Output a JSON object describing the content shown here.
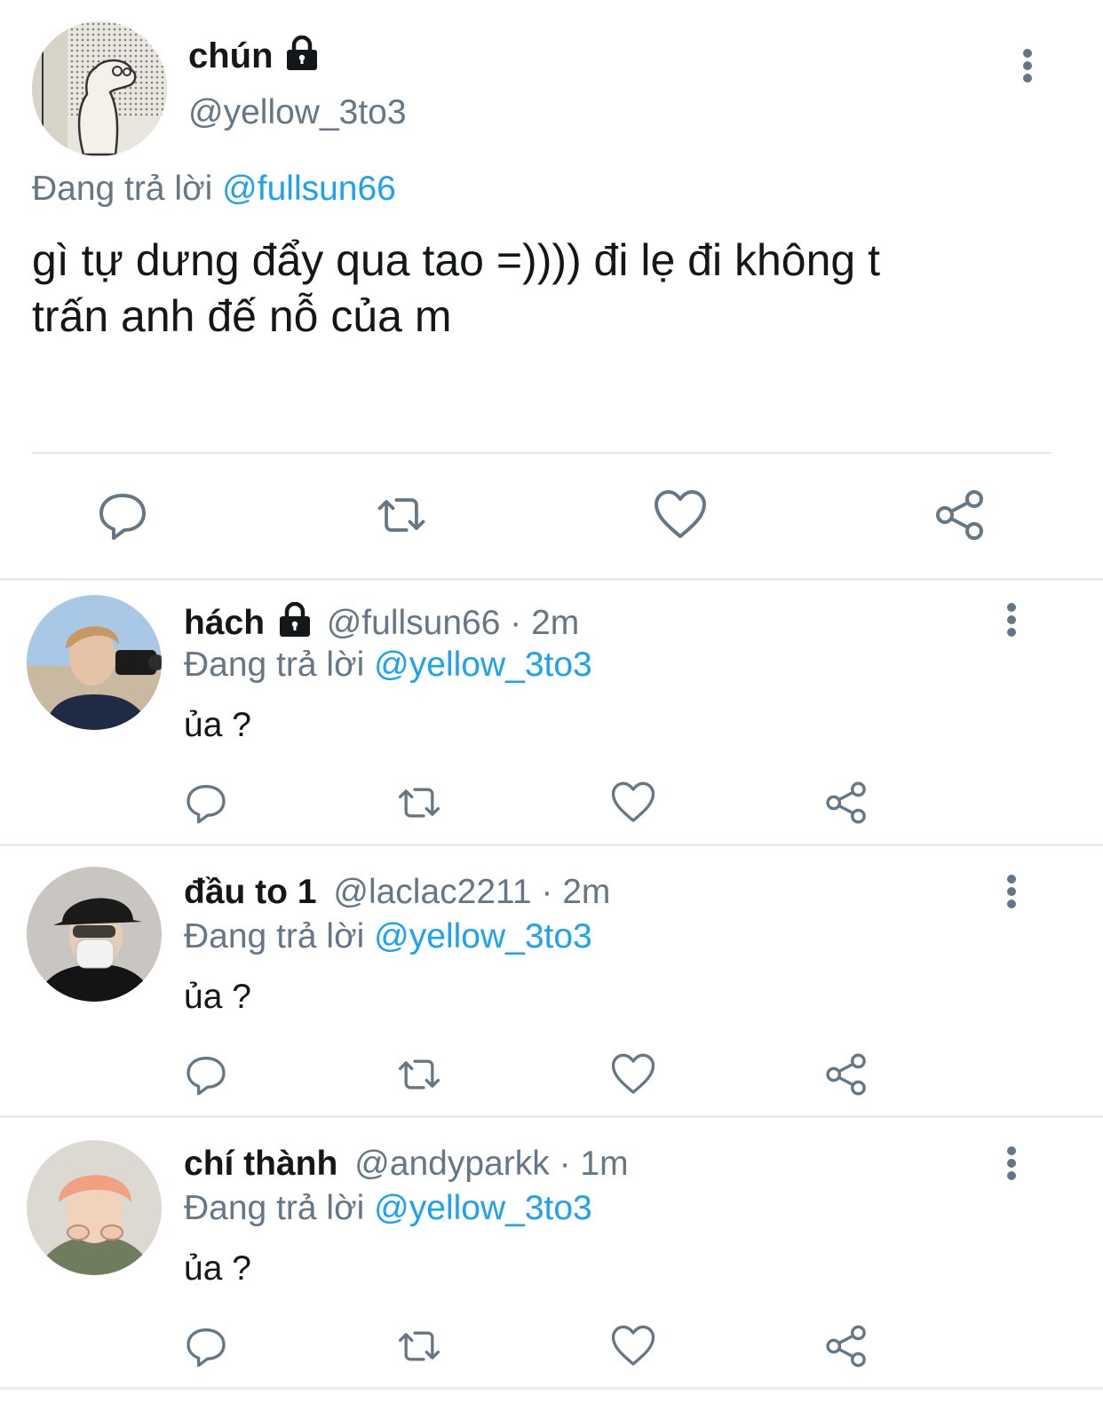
{
  "main_tweet": {
    "display_name": "chún",
    "handle": "@yellow_3to3",
    "replying_prefix": "Đang trả lời",
    "replying_to": "@fullsun66",
    "text_line1": "gì tự dưng đẩy qua tao =)))) đi lẹ đi không t",
    "text_line2": "trấn anh đế nỗ của m"
  },
  "replies": [
    {
      "display_name": "hách",
      "handle": "@fullsun66",
      "time": "· 2m",
      "replying_prefix": "Đang trả lời",
      "replying_to": "@yellow_3to3",
      "text": "ủa ?"
    },
    {
      "display_name": "đầu to 1",
      "handle": "@laclac2211",
      "time": "· 2m",
      "replying_prefix": "Đang trả lời",
      "replying_to": "@yellow_3to3",
      "text": "ủa ?"
    },
    {
      "display_name": "chí thành",
      "handle": "@andyparkk",
      "time": "· 1m",
      "replying_prefix": "Đang trả lời",
      "replying_to": "@yellow_3to3",
      "text": "ủa ?"
    }
  ],
  "icons": {
    "reply": "reply-icon",
    "retweet": "retweet-icon",
    "like": "heart-icon",
    "share": "share-icon",
    "more": "more-vertical-icon",
    "lock": "lock-icon"
  },
  "colors": {
    "link": "#1da1f2",
    "muted": "#657786",
    "icon": "#657786",
    "divider": "#e6ecf0"
  }
}
